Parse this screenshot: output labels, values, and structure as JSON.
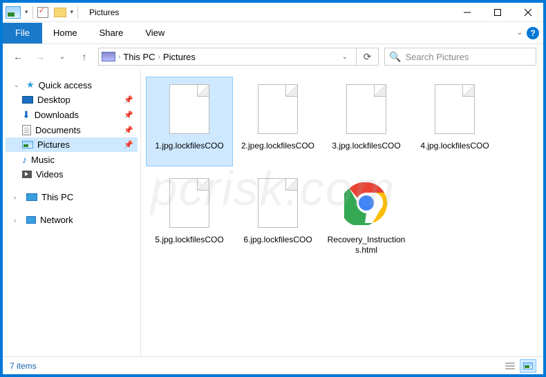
{
  "titlebar": {
    "title": "Pictures"
  },
  "ribbon": {
    "file": "File",
    "tabs": [
      "Home",
      "Share",
      "View"
    ]
  },
  "breadcrumbs": [
    "This PC",
    "Pictures"
  ],
  "search": {
    "placeholder": "Search Pictures"
  },
  "sidebar": {
    "quick_access": "Quick access",
    "items": [
      {
        "label": "Desktop",
        "pinned": true
      },
      {
        "label": "Downloads",
        "pinned": true
      },
      {
        "label": "Documents",
        "pinned": true
      },
      {
        "label": "Pictures",
        "pinned": true,
        "selected": true
      },
      {
        "label": "Music",
        "pinned": false
      },
      {
        "label": "Videos",
        "pinned": false
      }
    ],
    "this_pc": "This PC",
    "network": "Network"
  },
  "files": [
    {
      "name": "1.jpg.lockfilesCOO",
      "type": "blank",
      "selected": true
    },
    {
      "name": "2.jpeg.lockfilesCOO",
      "type": "blank"
    },
    {
      "name": "3.jpg.lockfilesCOO",
      "type": "blank"
    },
    {
      "name": "4.jpg.lockfilesCOO",
      "type": "blank"
    },
    {
      "name": "5.jpg.lockfilesCOO",
      "type": "blank"
    },
    {
      "name": "6.jpg.lockfilesCOO",
      "type": "blank"
    },
    {
      "name": "Recovery_Instructions.html",
      "type": "chrome"
    }
  ],
  "statusbar": {
    "count": "7 items"
  },
  "watermark": "pcrisk.com"
}
